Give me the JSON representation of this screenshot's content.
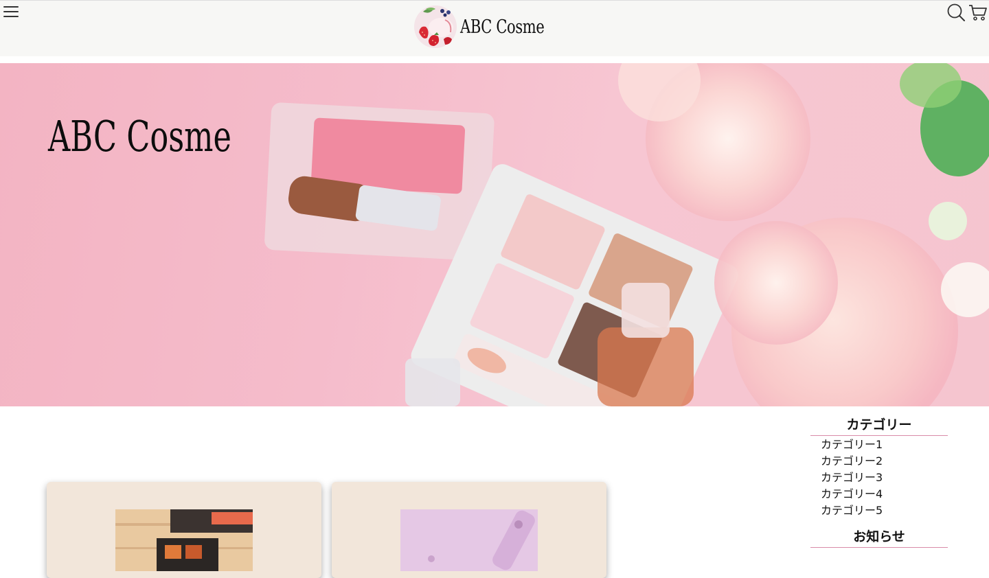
{
  "header": {
    "logo_text": "ABC Cosme",
    "icons": {
      "menu": "hamburger-menu-icon",
      "search": "search-icon",
      "cart": "cart-icon"
    }
  },
  "hero": {
    "title": "ABC Cosme"
  },
  "sidebar": {
    "categories_heading": "カテゴリー",
    "categories": [
      {
        "label": "カテゴリー1"
      },
      {
        "label": "カテゴリー2"
      },
      {
        "label": "カテゴリー3"
      },
      {
        "label": "カテゴリー4"
      },
      {
        "label": "カテゴリー5"
      }
    ],
    "news_heading": "お知らせ"
  },
  "colors": {
    "header_bg": "#f7f7f5",
    "hero_pink": "#f5bccb",
    "card_bg": "#f2e6da",
    "accent_underline": "#d98aa8"
  }
}
